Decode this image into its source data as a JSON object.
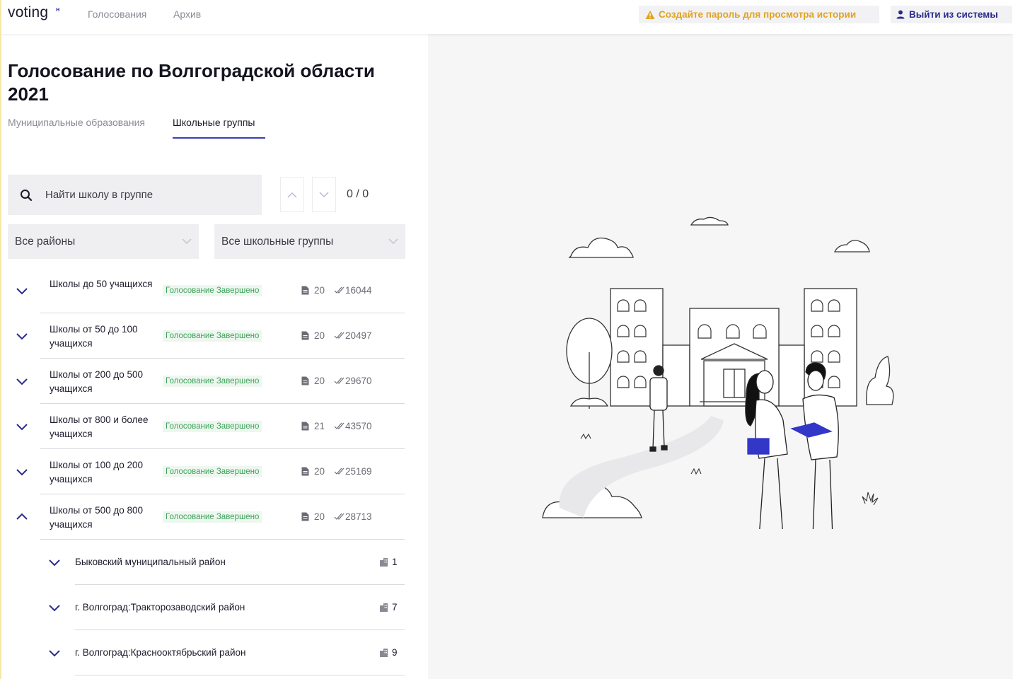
{
  "header": {
    "logo_text": "voting",
    "logo_mark": "н",
    "nav": [
      {
        "label": "Голосования"
      },
      {
        "label": "Архив"
      }
    ],
    "warning_button": {
      "label": "Создайте пароль для просмотра истории",
      "icon": "warning-triangle-icon",
      "color": "#e0a321"
    },
    "logout_button": {
      "label": "Выйти из системы",
      "icon": "user-icon",
      "color": "#2a2d8c"
    }
  },
  "page": {
    "title": "Голосование по Волгоградской области 2021",
    "tabs": [
      {
        "label": "Муниципальные образования",
        "active": false
      },
      {
        "label": "Школьные группы",
        "active": true
      }
    ]
  },
  "search": {
    "placeholder": "Найти школу в группе",
    "value": "",
    "counter": "0 / 0"
  },
  "filters": {
    "district": "Все районы",
    "school_group": "Все школьные группы"
  },
  "groups": [
    {
      "name": "Школы до 50 учащихся",
      "status": "Голосование Завершено",
      "docs": "20",
      "votes": "16044",
      "expanded": false
    },
    {
      "name": "Школы от 50 до 100 учащихся",
      "status": "Голосование Завершено",
      "docs": "20",
      "votes": "20497",
      "expanded": false
    },
    {
      "name": "Школы от 200 до 500 учащихся",
      "status": "Голосование Завершено",
      "docs": "20",
      "votes": "29670",
      "expanded": false
    },
    {
      "name": "Школы от 800 и более учащихся",
      "status": "Голосование Завершено",
      "docs": "21",
      "votes": "43570",
      "expanded": false
    },
    {
      "name": "Школы от 100 до 200 учащихся",
      "status": "Голосование Завершено",
      "docs": "20",
      "votes": "25169",
      "expanded": false
    },
    {
      "name": "Школы от 500 до 800 учащихся",
      "status": "Голосование Завершено",
      "docs": "20",
      "votes": "28713",
      "expanded": true
    }
  ],
  "districts": [
    {
      "name": "Быковский муниципальный район",
      "count": "1"
    },
    {
      "name": "г. Волгоград:Тракторозаводский район",
      "count": "7"
    },
    {
      "name": "г. Волгоград:Краснооктябрьский район",
      "count": "9"
    }
  ],
  "colors": {
    "accent": "#3b3fb4",
    "status_green": "#3fa35a",
    "status_bg": "#edf7ef",
    "warning": "#e0a321"
  }
}
